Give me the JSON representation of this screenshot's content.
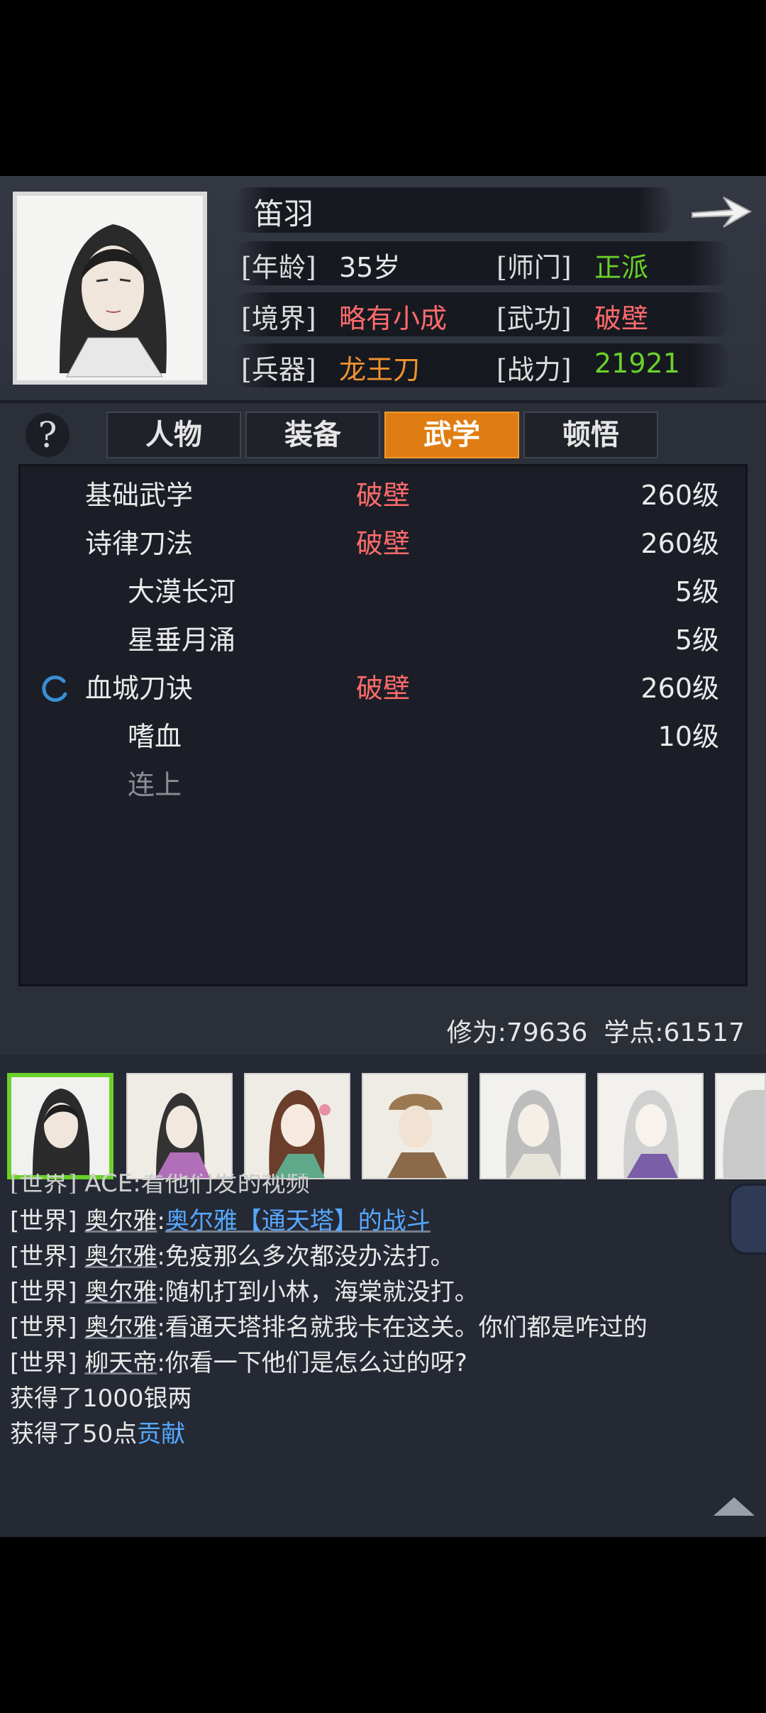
{
  "character": {
    "name": "笛羽",
    "age_label": "[年龄]",
    "age": "35岁",
    "sect_label": "[师门]",
    "sect": "正派",
    "realm_label": "[境界]",
    "realm": "略有小成",
    "martial_label": "[武功]",
    "martial": "破壁",
    "weapon_label": "[兵器]",
    "weapon": "龙王刀",
    "power_label": "[战力]",
    "power": "21921"
  },
  "tabs": [
    {
      "label": "人物"
    },
    {
      "label": "装备"
    },
    {
      "label": "武学"
    },
    {
      "label": "顿悟"
    }
  ],
  "help_symbol": "?",
  "skills": [
    {
      "name": "基础武学",
      "status": "破壁",
      "level": "260级"
    },
    {
      "name": "诗律刀法",
      "status": "破壁",
      "level": "260级"
    },
    {
      "name": "大漠长河",
      "status": "",
      "level": "5级"
    },
    {
      "name": "星垂月涌",
      "status": "",
      "level": "5级"
    },
    {
      "name": "血城刀诀",
      "status": "破壁",
      "level": "260级"
    },
    {
      "name": "嗜血",
      "status": "",
      "level": "10级"
    },
    {
      "name": "连上",
      "status": "",
      "level": ""
    }
  ],
  "stats_footer": "修为:79636  学点:61517",
  "chat": {
    "partial_line": "[世界] ACE:看他们发的视频",
    "lines": [
      {
        "channel": "[世界]",
        "user": "奥尔雅",
        "text": ":",
        "link": "奥尔雅【通天塔】的战斗"
      },
      {
        "channel": "[世界]",
        "user": "奥尔雅",
        "text": ":免疫那么多次都没办法打。",
        "link": ""
      },
      {
        "channel": "[世界]",
        "user": "奥尔雅",
        "text": ":随机打到小林，海棠就没打。",
        "link": ""
      },
      {
        "channel": "[世界]",
        "user": "奥尔雅",
        "text": ":看通天塔排名就我卡在这关。你们都是咋过的",
        "link": ""
      },
      {
        "channel": "[世界]",
        "user": "柳天帝",
        "text": ":你看一下他们是怎么过的呀?",
        "link": ""
      }
    ],
    "system": [
      {
        "text": "获得了1000银两",
        "link": ""
      },
      {
        "text": "获得了50点",
        "link": "贡献"
      }
    ]
  },
  "colors": {
    "accent_orange": "#e07d12",
    "green": "#6ad12a",
    "red": "#ff6b6b",
    "link_blue": "#55a8ff"
  },
  "icons": [
    "arrow-right-icon",
    "help-icon",
    "loading-spinner-icon",
    "scroll-up-icon"
  ]
}
